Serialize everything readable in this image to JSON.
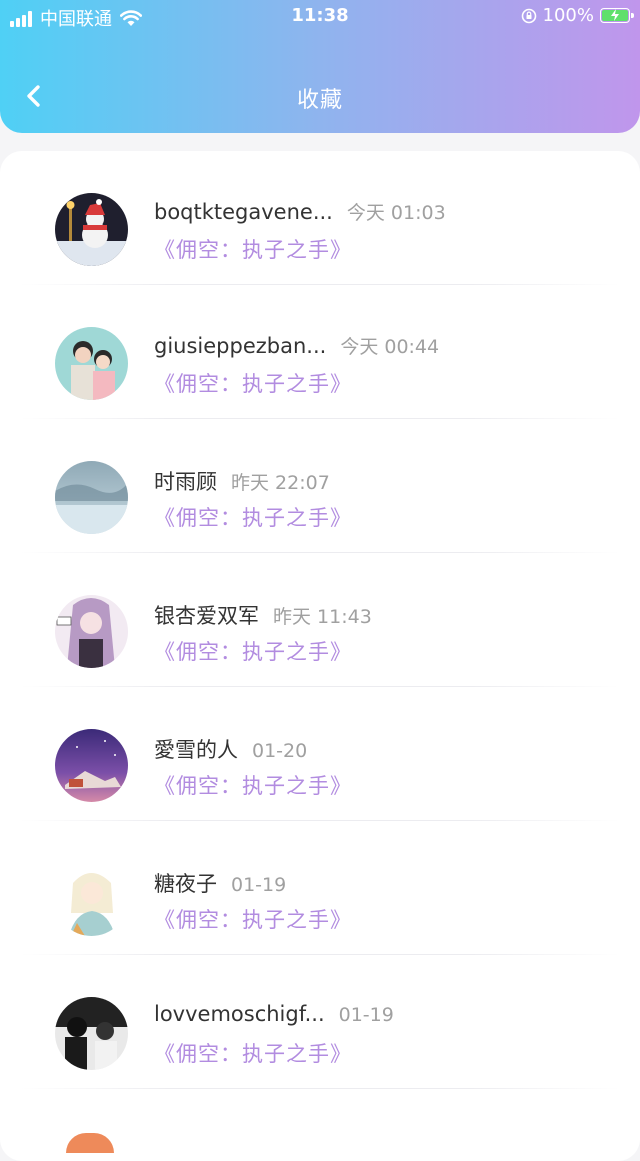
{
  "status_bar": {
    "carrier": "中国联通",
    "time": "11:38",
    "battery": "100%",
    "battery_level": 1.0,
    "icons": [
      "signal-icon",
      "wifi-icon",
      "rotation-lock-icon",
      "battery-charging-icon"
    ]
  },
  "header": {
    "title": "收藏",
    "back_icon": "chevron-left-icon"
  },
  "colors": {
    "header_gradient": [
      "#4fd0f5",
      "#8fb4ee",
      "#c096ec"
    ],
    "book_title": "#b28ce0",
    "time_text": "#a0a0a0"
  },
  "items": [
    {
      "name": "boqtktegavene...",
      "time": "今天 01:03",
      "book": "《佣空：执子之手》"
    },
    {
      "name": "giusieppezban...",
      "time": "今天 00:44",
      "book": "《佣空：执子之手》"
    },
    {
      "name": "时雨顾",
      "time": "昨天 22:07",
      "book": "《佣空：执子之手》"
    },
    {
      "name": "银杏爱双军",
      "time": "昨天 11:43",
      "book": "《佣空：执子之手》"
    },
    {
      "name": "愛雪的人",
      "time": "01-20",
      "book": "《佣空：执子之手》"
    },
    {
      "name": "糖夜子",
      "time": "01-19",
      "book": "《佣空：执子之手》"
    },
    {
      "name": "lovvemoschigf...",
      "time": "01-19",
      "book": "《佣空：执子之手》"
    }
  ]
}
